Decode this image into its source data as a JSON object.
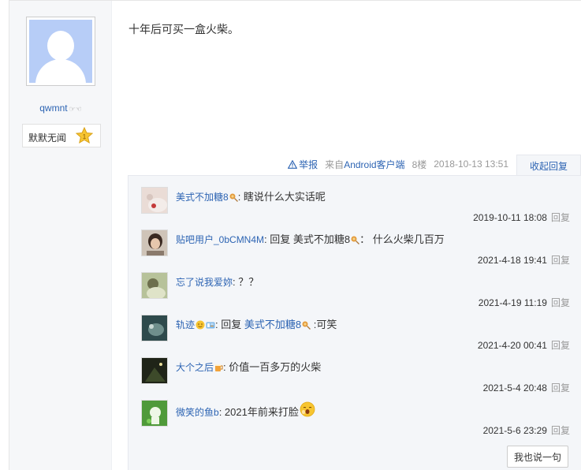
{
  "author": {
    "username": "qwmnt",
    "username_suffix": "☞☜",
    "level_label": "默默无闻",
    "level_number": "1"
  },
  "post": {
    "content": "十年后可买一盒火柴。"
  },
  "tail": {
    "report_label": "举报",
    "from_prefix": "来自",
    "from_client": "Android客户端",
    "floor": "8楼",
    "datetime": "2018-10-13 13:51",
    "collapse_label": "收起回复"
  },
  "replies": [
    {
      "user": "美式不加糖8",
      "sep": ":",
      "text": " 瞎说什么大实话呢",
      "time": "2019-10-11 18:08",
      "reply_label": "回复"
    },
    {
      "user": "贴吧用户_0bCMN4M",
      "sep": ":",
      "prefix": " 回复 ",
      "target": "美式不加糖8",
      "text": "：  什么火柴几百万",
      "time": "2021-4-18 19:41",
      "reply_label": "回复"
    },
    {
      "user": "忘了说我爱妳",
      "sep": ":",
      "text": " ？？",
      "time": "2021-4-19 11:19",
      "reply_label": "回复"
    },
    {
      "user": "轨迹",
      "sep": ":",
      "prefix": " 回复 ",
      "target": "美式不加糖8",
      "text": " :可笑",
      "time": "2021-4-20 00:41",
      "reply_label": "回复"
    },
    {
      "user": "大个之后",
      "sep": ":",
      "text": " 价值一百多万的火柴",
      "time": "2021-5-4 20:48",
      "reply_label": "回复"
    },
    {
      "user": "微笑的鱼b",
      "sep": ":",
      "text": " 2021年前来打脸",
      "time": "2021-5-6 23:29",
      "reply_label": "回复"
    }
  ],
  "say_button_label": "我也说一句",
  "colors": {
    "link": "#2d64b3",
    "panel_bg": "#f4f6f9",
    "left_bg": "#f6f7f9"
  }
}
